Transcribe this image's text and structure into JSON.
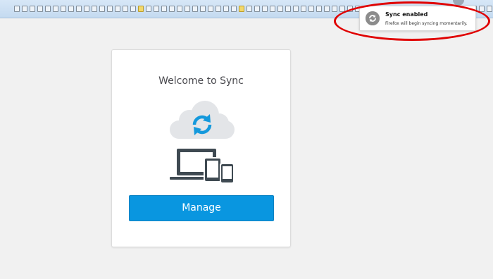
{
  "toolbar": {
    "bookmarks": [
      "page",
      "page",
      "page",
      "page",
      "page",
      "page",
      "page",
      "page",
      "page",
      "page",
      "page",
      "page",
      "page",
      "page",
      "page",
      "page",
      "folder",
      "page",
      "page",
      "page",
      "page",
      "page",
      "page",
      "page",
      "page",
      "page",
      "page",
      "page",
      "page",
      "folder",
      "page",
      "page",
      "page",
      "page",
      "page",
      "page",
      "page",
      "page",
      "page",
      "page",
      "page",
      "page",
      "page",
      "page",
      "page",
      "page",
      "page",
      "page",
      "folder",
      "page",
      "page",
      "page",
      "page",
      "page",
      "page",
      "page",
      "page",
      "page",
      "page",
      "page",
      "page",
      "page",
      "page",
      "page",
      "page",
      "folder",
      "page",
      "page",
      "page",
      "page",
      "page",
      "page",
      "page",
      "page",
      "page",
      "page",
      "page",
      "page",
      "page",
      "page",
      "page",
      "page",
      "folder",
      "page",
      "page",
      "page",
      "page",
      "page",
      "page",
      "page",
      "page",
      "page",
      "page",
      "page",
      "page",
      "page",
      "page",
      "page",
      "page",
      "folder"
    ]
  },
  "notification": {
    "title": "Sync enabled",
    "message": "Firefox will begin syncing momentarily.",
    "icon": "sync-icon"
  },
  "card": {
    "title": "Welcome to Sync",
    "illustration": "cloud-sync-devices",
    "manage_label": "Manage"
  },
  "colors": {
    "accent": "#0996e0",
    "annotation": "#e00000"
  }
}
